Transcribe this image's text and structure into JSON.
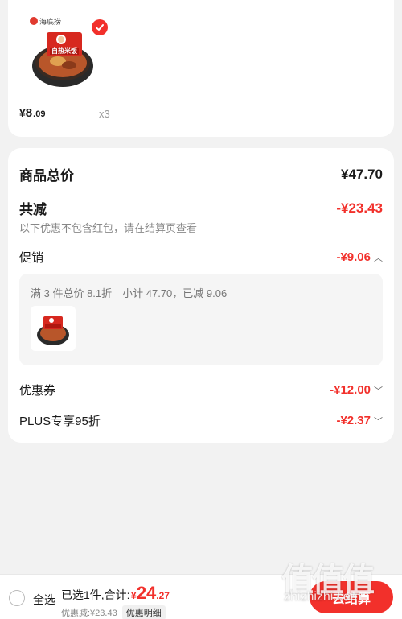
{
  "product": {
    "brand_logo_text": "海底捞",
    "package_text": "自热米饭",
    "price_currency": "¥",
    "price_int": "8",
    "price_dec": ".09",
    "quantity": "x3",
    "selected": true
  },
  "summary": {
    "total_label": "商品总价",
    "total_value": "¥47.70",
    "reduction_label": "共减",
    "reduction_value": "-¥23.43",
    "reduction_note": "以下优惠不包含红包，请在结算页查看",
    "promo_label": "促销",
    "promo_value": "-¥9.06",
    "promo_desc_left": "满 3 件总价 8.1折",
    "promo_desc_right": "小计 47.70，已减 9.06",
    "coupon_label": "优惠券",
    "coupon_value": "-¥12.00",
    "plus_label": "PLUS专享95折",
    "plus_value": "-¥2.37"
  },
  "bottom": {
    "select_all": "全选",
    "selected_text": "已选1件,合计:",
    "total_currency": "¥",
    "total_int": "24",
    "total_dec": ".27",
    "discount_text": "优惠减:¥23.43",
    "detail_button": "优惠明细",
    "checkout_button": "去结算"
  },
  "watermark": {
    "logo": "值值值",
    "text": "zhizhizhi.com"
  },
  "colors": {
    "accent": "#f2302b",
    "background": "#f2f2f2"
  }
}
